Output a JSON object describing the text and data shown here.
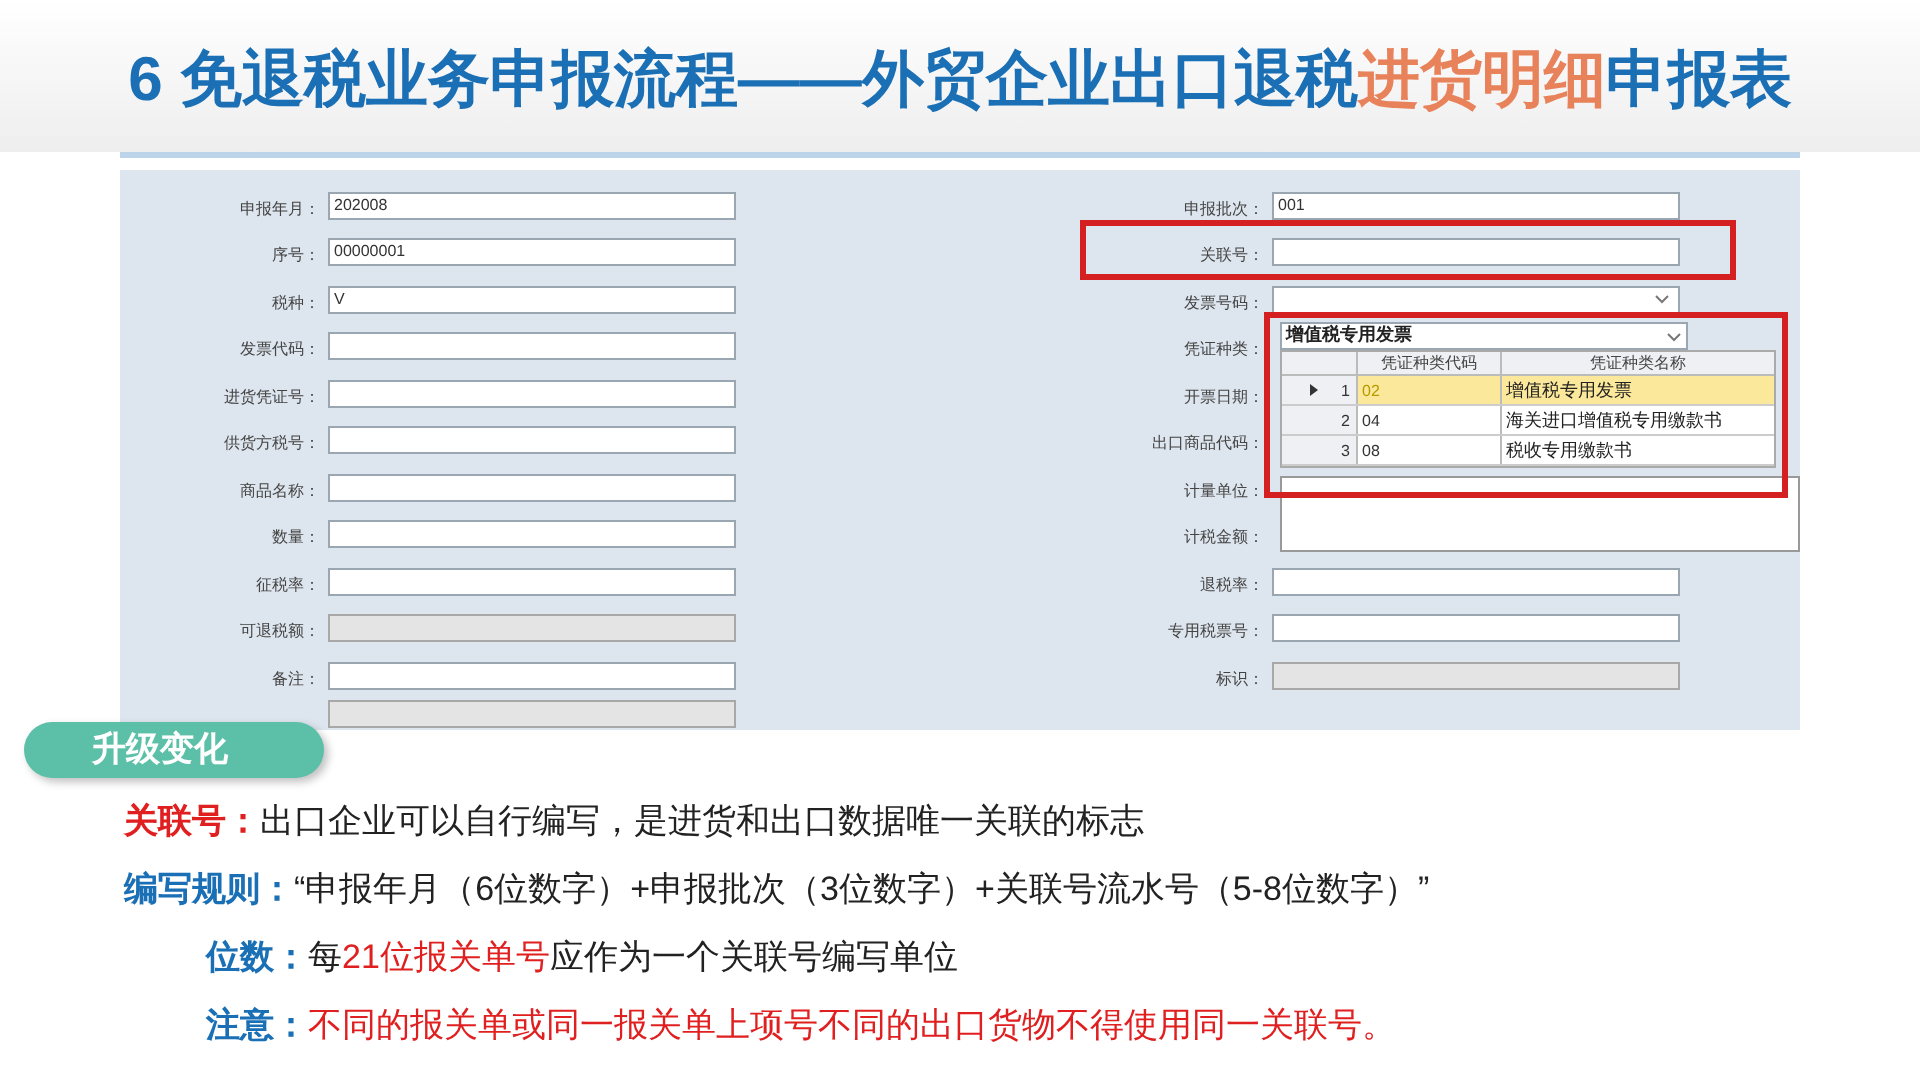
{
  "title": [
    {
      "text": "6 免退税业务申报流程——外贸企业出口退税",
      "color": "#1a6fb5"
    },
    {
      "text": "进货明细",
      "color": "#e8825a"
    },
    {
      "text": "申报表",
      "color": "#1a6fb5"
    }
  ],
  "form": {
    "left_fields": [
      {
        "label": "申报年月：",
        "value": "202008",
        "kind": "text"
      },
      {
        "label": "序号：",
        "value": "00000001",
        "kind": "text"
      },
      {
        "label": "税种：",
        "value": "V",
        "kind": "text"
      },
      {
        "label": "发票代码：",
        "kind": "text"
      },
      {
        "label": "进货凭证号：",
        "kind": "text"
      },
      {
        "label": "供货方税号：",
        "kind": "text"
      },
      {
        "label": "商品名称：",
        "kind": "text"
      },
      {
        "label": "数量：",
        "kind": "text"
      },
      {
        "label": "征税率：",
        "kind": "text"
      },
      {
        "label": "可退税额：",
        "kind": "disabled"
      },
      {
        "label": "备注：",
        "kind": "text"
      },
      {
        "kind": "disabled"
      }
    ],
    "right_fields": [
      {
        "label": "申报批次：",
        "value": "001",
        "kind": "text",
        "highlighted": false
      },
      {
        "label": "关联号：",
        "kind": "text",
        "highlighted": true
      },
      {
        "label": "发票号码：",
        "kind": "dropdown",
        "highlighted": false
      },
      {
        "label": "凭证种类：",
        "kind": "covered",
        "highlighted": false
      },
      {
        "label": "开票日期：",
        "kind": "covered",
        "highlighted": false
      },
      {
        "label": "出口商品代码：",
        "kind": "covered",
        "highlighted": false
      },
      {
        "label": "计量单位：",
        "kind": "covered",
        "highlighted": false
      },
      {
        "label": "计税金额：",
        "kind": "covered",
        "highlighted": false
      },
      {
        "label": "退税率：",
        "kind": "text",
        "highlighted": false
      },
      {
        "label": "专用税票号：",
        "kind": "text",
        "highlighted": false
      },
      {
        "label": "标识：",
        "kind": "disabled",
        "highlighted": false
      }
    ],
    "popup": {
      "value": "增值税专用发票",
      "highlighted": true,
      "columns": [
        "凭证种类代码",
        "凭证种类名称"
      ],
      "rows": [
        {
          "index": "1",
          "code": "02",
          "name": "增值税专用发票",
          "selected": true
        },
        {
          "index": "2",
          "code": "04",
          "name": "海关进口增值税专用缴款书",
          "selected": false
        },
        {
          "index": "3",
          "code": "08",
          "name": "税收专用缴款书",
          "selected": false
        }
      ]
    }
  },
  "badge": "升级变化",
  "notes": [
    {
      "label": "关联号：",
      "color": "#e02020",
      "segments": [
        {
          "text": "出口企业可以自行编写，是进货和出口数据唯一关联的标志",
          "color": "#222222"
        }
      ]
    },
    {
      "label": "编写规则：",
      "color": "#1a6fb5",
      "segments": [
        {
          "text": "“申报年月（6位数字）+申报批次（3位数字）+关联号流水号（5-8位数字）”",
          "color": "#222222"
        }
      ],
      "children": [
        {
          "label": "位数：",
          "color": "#1a6fb5",
          "segments": [
            {
              "text": "每",
              "color": "#222222"
            },
            {
              "text": "21位报关单号",
              "color": "#e02020"
            },
            {
              "text": "应作为一个关联号编写单位",
              "color": "#222222"
            }
          ]
        },
        {
          "label": "注意：",
          "color": "#1a6fb5",
          "segments": [
            {
              "text": "不同的报关单或同一报关单上项号不同的出口货物不得使用同一关联号。",
              "color": "#e02020"
            }
          ]
        }
      ]
    }
  ]
}
